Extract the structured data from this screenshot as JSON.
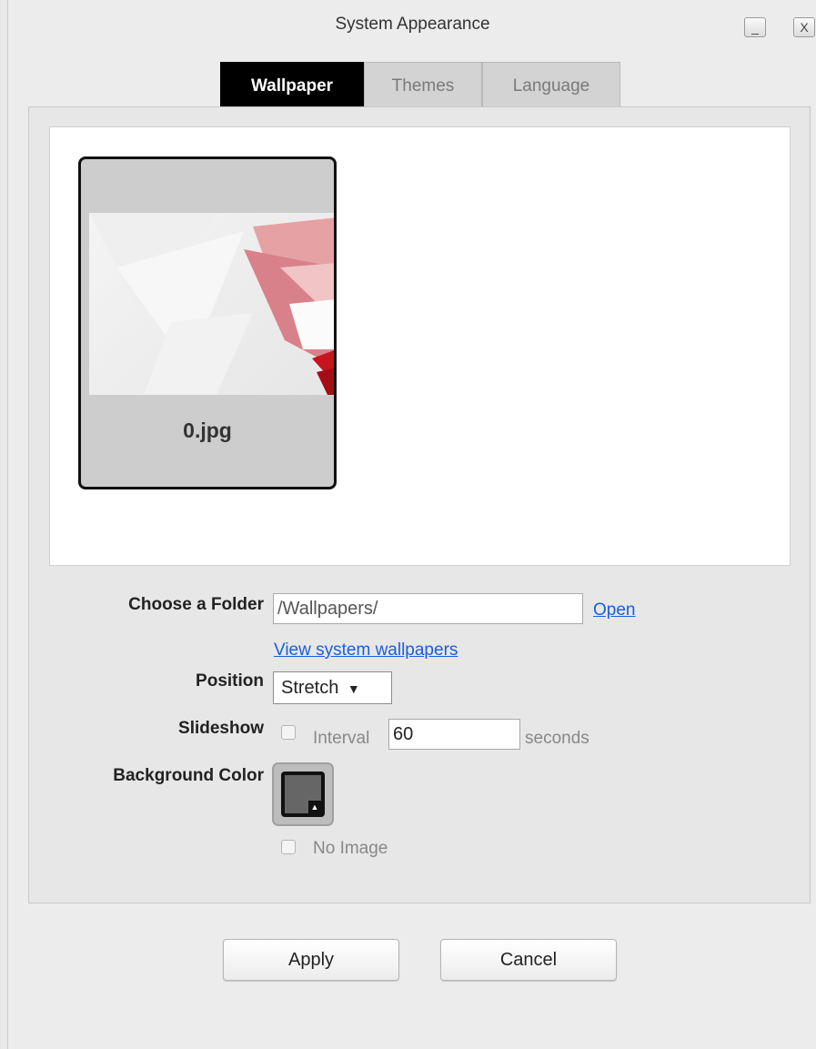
{
  "window": {
    "title": "System Appearance",
    "minimize_label": "_",
    "close_label": "X"
  },
  "tabs": [
    {
      "label": "Wallpaper",
      "active": true
    },
    {
      "label": "Themes",
      "active": false
    },
    {
      "label": "Language",
      "active": false
    }
  ],
  "gallery": {
    "items": [
      {
        "name": "0.jpg",
        "selected": true
      }
    ]
  },
  "form": {
    "folder_label": "Choose a Folder",
    "folder_value": "/Wallpapers/",
    "open_link": "Open",
    "system_wallpapers_link": "View system wallpapers",
    "position_label": "Position",
    "position_value": "Stretch",
    "position_arrow": "▼",
    "slideshow_label": "Slideshow",
    "interval_label": "Interval",
    "interval_value": "60",
    "seconds_label": "seconds",
    "bgcolor_label": "Background Color",
    "bgcolor_value": "#666666",
    "no_image_label": "No Image"
  },
  "buttons": {
    "apply_label": "Apply",
    "cancel_label": "Cancel"
  }
}
